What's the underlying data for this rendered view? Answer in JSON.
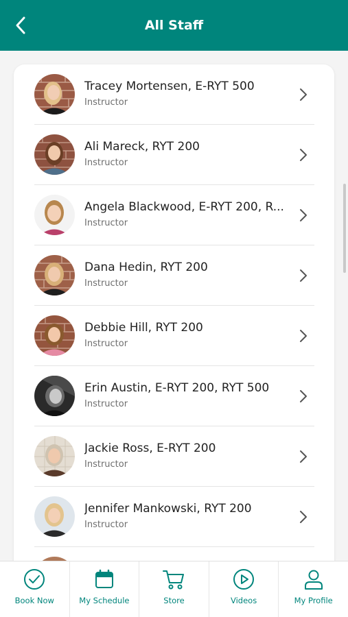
{
  "header": {
    "title": "All Staff",
    "back_icon": "chevron-left-icon"
  },
  "staff": [
    {
      "name": "Tracey Mortensen, E-RYT 500",
      "role": "Instructor"
    },
    {
      "name": "Ali Mareck, RYT 200",
      "role": "Instructor"
    },
    {
      "name": "Angela Blackwood, E-RYT 200, R...",
      "role": "Instructor"
    },
    {
      "name": "Dana Hedin, RYT 200",
      "role": "Instructor"
    },
    {
      "name": "Debbie Hill, RYT 200",
      "role": "Instructor"
    },
    {
      "name": "Erin Austin, E-RYT 200, RYT 500",
      "role": "Instructor"
    },
    {
      "name": "Jackie Ross, E-RYT 200",
      "role": "Instructor"
    },
    {
      "name": "Jennifer Mankowski, RYT 200",
      "role": "Instructor"
    }
  ],
  "tabs": [
    {
      "label": "Book Now",
      "icon": "check-circle-icon"
    },
    {
      "label": "My Schedule",
      "icon": "calendar-icon"
    },
    {
      "label": "Store",
      "icon": "cart-icon"
    },
    {
      "label": "Videos",
      "icon": "play-circle-icon"
    },
    {
      "label": "My Profile",
      "icon": "person-icon"
    }
  ],
  "colors": {
    "brand": "#00857c",
    "text": "#222222",
    "subtext": "#6e6e6e"
  }
}
